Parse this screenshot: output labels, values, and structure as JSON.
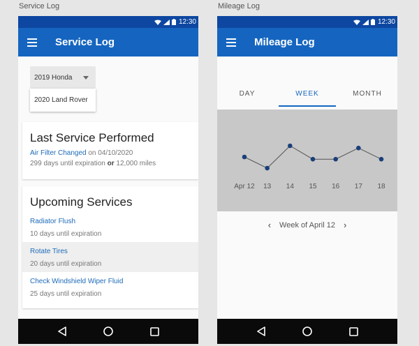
{
  "captions": {
    "left": "Service Log",
    "right": "Mileage Log"
  },
  "status": {
    "time": "12:30"
  },
  "service_log": {
    "app_title": "Service Log",
    "vehicle_select": {
      "selected": "2019 Honda",
      "options": [
        "2020 Land Rover"
      ]
    },
    "last_service": {
      "heading": "Last Service Performed",
      "service_name": "Air Filter Changed",
      "on_word": "on",
      "date": "04/10/2020",
      "days": "299 days until expiration",
      "or_word": "or",
      "miles": "12,000 miles"
    },
    "upcoming": {
      "heading": "Upcoming Services",
      "items": [
        {
          "name": "Radiator Flush",
          "expiration": "10 days until expiration"
        },
        {
          "name": "Rotate Tires",
          "expiration": "20 days until expiration"
        },
        {
          "name": "Check Windshield Wiper Fluid",
          "expiration": "25 days until expiration"
        }
      ]
    }
  },
  "mileage_log": {
    "app_title": "Mileage Log",
    "tabs": [
      "DAY",
      "WEEK",
      "MONTH"
    ],
    "active_tab": "WEEK",
    "week_label": "Week of April 12",
    "colors": {
      "line": "#555555",
      "point": "#1a3f7a",
      "chart_bg": "#c8c8c8"
    }
  },
  "chart_data": {
    "type": "line",
    "categories": [
      "Apr 12",
      "13",
      "14",
      "15",
      "16",
      "17",
      "18"
    ],
    "series": [
      {
        "values": [
          6,
          5,
          7,
          5.8,
          5.8,
          6.8,
          5.8
        ]
      }
    ],
    "title": "",
    "xlabel": "",
    "ylabel": "",
    "ylim": [
      4,
      8
    ],
    "grid": false
  }
}
